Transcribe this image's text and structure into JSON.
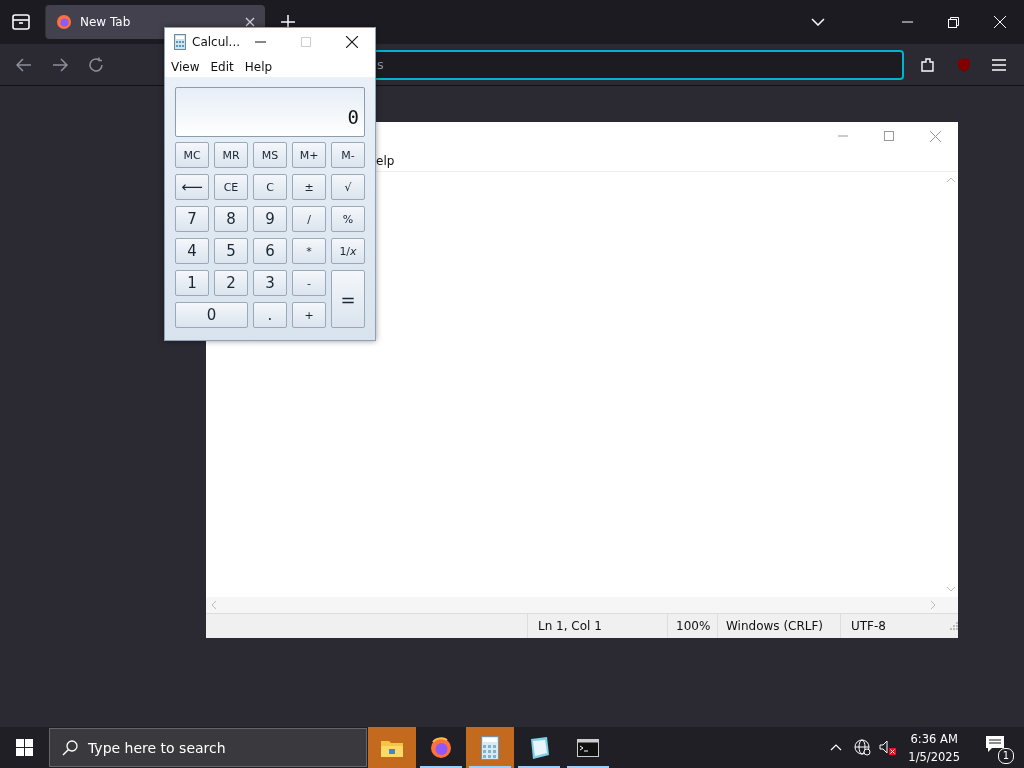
{
  "browser": {
    "tabs": [
      {
        "label": "New Tab",
        "selected": true
      }
    ],
    "url_field": {
      "placeholder": "s"
    }
  },
  "notepad": {
    "menu": [
      "elp"
    ],
    "status_bar": [
      "Ln 1, Col 1",
      "100%",
      "Windows (CRLF)",
      "UTF-8"
    ]
  },
  "calculator": {
    "title": "Calcul...",
    "menu": [
      "View",
      "Edit",
      "Help"
    ],
    "display": "0",
    "keys": [
      {
        "label": "MC",
        "kind": "small"
      },
      {
        "label": "MR",
        "kind": "small"
      },
      {
        "label": "MS",
        "kind": "small"
      },
      {
        "label": "M+",
        "kind": "small"
      },
      {
        "label": "M-",
        "kind": "small"
      },
      {
        "label": "⟵",
        "kind": "normal"
      },
      {
        "label": "CE",
        "kind": "small"
      },
      {
        "label": "C",
        "kind": "small"
      },
      {
        "label": "±",
        "kind": "small"
      },
      {
        "label": "√",
        "kind": "small"
      },
      {
        "label": "7",
        "kind": "normal"
      },
      {
        "label": "8",
        "kind": "normal"
      },
      {
        "label": "9",
        "kind": "normal"
      },
      {
        "label": "/",
        "kind": "small"
      },
      {
        "label": "%",
        "kind": "small"
      },
      {
        "label": "4",
        "kind": "normal"
      },
      {
        "label": "5",
        "kind": "normal"
      },
      {
        "label": "6",
        "kind": "normal"
      },
      {
        "label": "*",
        "kind": "small"
      },
      {
        "label": "1/*x*",
        "kind": "small"
      },
      {
        "label": "1",
        "kind": "normal"
      },
      {
        "label": "2",
        "kind": "normal"
      },
      {
        "label": "3",
        "kind": "normal"
      },
      {
        "label": "-",
        "kind": "small"
      },
      {
        "label": "=",
        "kind": "tall"
      },
      {
        "label": "0",
        "kind": "wide"
      },
      {
        "label": ".",
        "kind": "normal"
      },
      {
        "label": "+",
        "kind": "small"
      }
    ]
  },
  "taskbar": {
    "search": {
      "placeholder": "Type here to search"
    },
    "apps": [
      {
        "kind": "folder",
        "selected": true,
        "running": false
      },
      {
        "kind": "browser",
        "selected": false,
        "running": true
      },
      {
        "kind": "calculator",
        "selected": true,
        "running": true
      },
      {
        "kind": "notepad",
        "selected": false,
        "running": true
      },
      {
        "kind": "terminal",
        "selected": false,
        "running": true
      }
    ],
    "clock": {
      "time": "6:36 AM",
      "date": "1/5/2025"
    },
    "notification_count": "1"
  }
}
